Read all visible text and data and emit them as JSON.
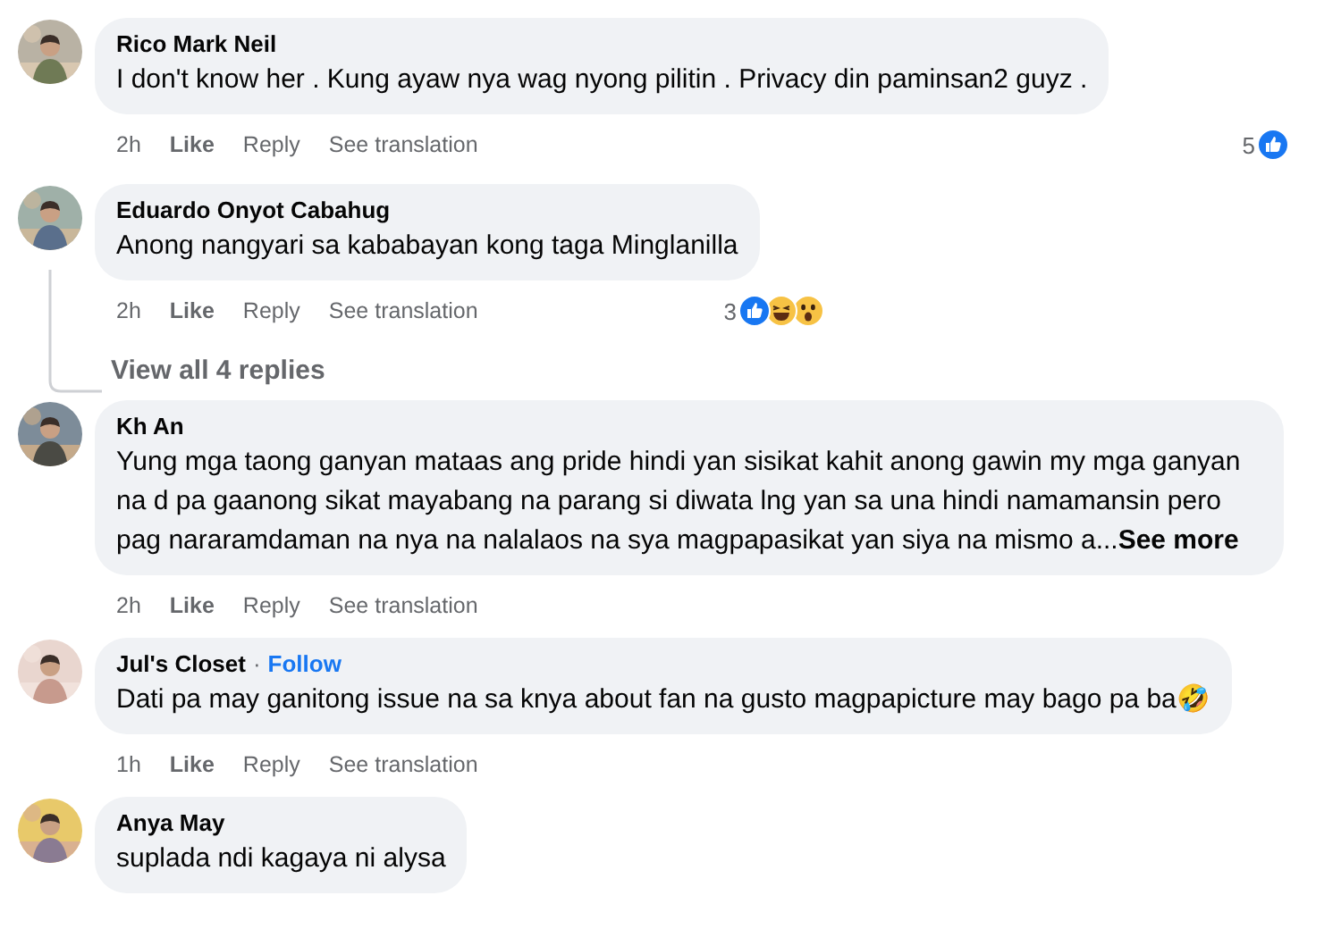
{
  "comments": [
    {
      "author": "Rico Mark Neil",
      "text": "I don't know her . Kung ayaw nya wag nyong pilitin . Privacy din paminsan2 guyz .",
      "meta": {
        "time": "2h",
        "like": "Like",
        "reply": "Reply",
        "translate": "See translation"
      },
      "reaction_count": "5",
      "reactions": [
        {
          "kind": "like"
        }
      ]
    },
    {
      "author": "Eduardo Onyot Cabahug",
      "text": "Anong nangyari sa kababayan kong taga Minglanilla",
      "meta": {
        "time": "2h",
        "like": "Like",
        "reply": "Reply",
        "translate": "See translation"
      },
      "reaction_count": "3",
      "reactions": [
        {
          "kind": "like"
        },
        {
          "kind": "haha"
        },
        {
          "kind": "wow"
        }
      ],
      "view_replies": "View all 4 replies"
    },
    {
      "author": "Kh An",
      "text": "Yung mga taong ganyan mataas ang pride hindi yan sisikat kahit anong gawin my mga ganyan na d pa gaanong sikat mayabang na parang si diwata lng yan sa una hindi namamansin pero pag nararamdaman na nya na nalalaos na sya magpapasikat yan siya na mismo a...",
      "see_more": "See more",
      "meta": {
        "time": "2h",
        "like": "Like",
        "reply": "Reply",
        "translate": "See translation"
      }
    },
    {
      "author": "Jul's Closet",
      "follow": {
        "separator": "·",
        "label": "Follow"
      },
      "text": "Dati pa may ganitong issue na sa knya about fan na gusto magpapicture may bago pa ba🤣",
      "meta": {
        "time": "1h",
        "like": "Like",
        "reply": "Reply",
        "translate": "See translation"
      }
    },
    {
      "author": "Anya May",
      "text": "suplada ndi kagaya ni alysa"
    }
  ]
}
